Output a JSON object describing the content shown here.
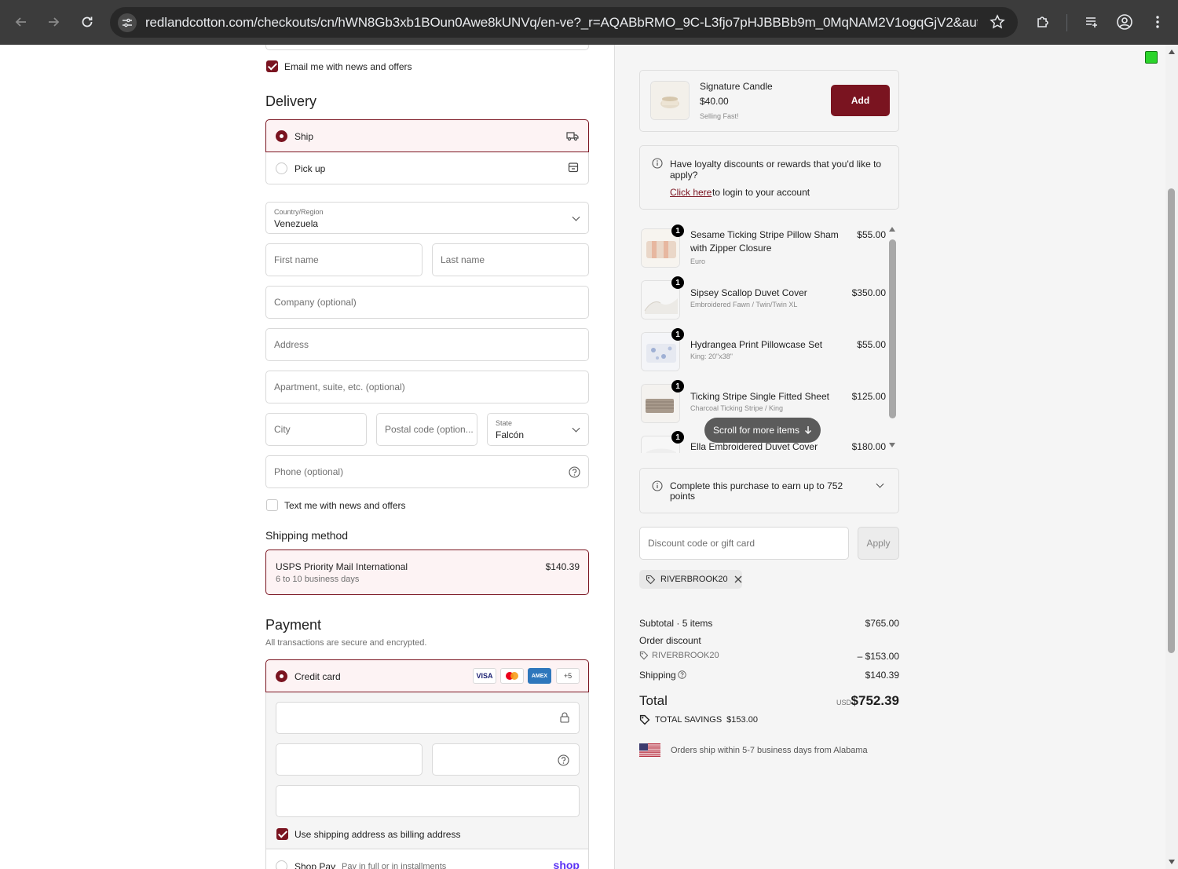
{
  "browser": {
    "url": "redlandcotton.com/checkouts/cn/hWN8Gb3xb1BOun0Awe8kUNVq/en-ve?_r=AQABbRMO_9C-L3fjo7pHJBBBb9m_0MqNAM2V1ogqGjV2&auto_r..."
  },
  "contact": {
    "email_news_label": "Email me with news and offers",
    "email_news_checked": true
  },
  "delivery": {
    "heading": "Delivery",
    "options": [
      {
        "label": "Ship",
        "selected": true,
        "icon": "truck-icon"
      },
      {
        "label": "Pick up",
        "selected": false,
        "icon": "store-icon"
      }
    ],
    "country": {
      "label": "Country/Region",
      "value": "Venezuela"
    },
    "first_name_placeholder": "First name",
    "last_name_placeholder": "Last name",
    "company_placeholder": "Company (optional)",
    "address_placeholder": "Address",
    "apartment_placeholder": "Apartment, suite, etc. (optional)",
    "city_placeholder": "City",
    "postal_placeholder": "Postal code (option...",
    "state": {
      "label": "State",
      "value": "Falcón"
    },
    "phone_placeholder": "Phone (optional)",
    "text_news_label": "Text me with news and offers"
  },
  "shipping_method": {
    "heading": "Shipping method",
    "name": "USPS Priority Mail International",
    "eta": "6 to 10 business days",
    "price": "$140.39"
  },
  "payment": {
    "heading": "Payment",
    "subheading": "All transactions are secure and encrypted.",
    "credit_card_label": "Credit card",
    "card_brands": [
      "VISA",
      "",
      "AMEX",
      "+5"
    ],
    "billing_label": "Use shipping address as billing address",
    "shop_pay_label": "Shop Pay",
    "shop_pay_sub": "Pay in full or in installments",
    "shop_logo": "shop"
  },
  "upsell": {
    "name": "Signature Candle",
    "price": "$40.00",
    "note": "Selling Fast!",
    "button": "Add"
  },
  "loyalty": {
    "question": "Have loyalty discounts or rewards that you'd like to apply?",
    "link": "Click here",
    "rest": "to login to your account"
  },
  "cart": {
    "items": [
      {
        "qty": "1",
        "title": "Sesame Ticking Stripe Pillow Sham with Zipper Closure",
        "variant": "Euro",
        "price": "$55.00"
      },
      {
        "qty": "1",
        "title": "Sipsey Scallop Duvet Cover",
        "variant": "Embroidered Fawn / Twin/Twin XL",
        "price": "$350.00"
      },
      {
        "qty": "1",
        "title": "Hydrangea Print Pillowcase Set",
        "variant": "King: 20\"x38\"",
        "price": "$55.00"
      },
      {
        "qty": "1",
        "title": "Ticking Stripe Single Fitted Sheet",
        "variant": "Charcoal Ticking Stripe / King",
        "price": "$125.00"
      },
      {
        "qty": "1",
        "title": "Ella Embroidered Duvet Cover",
        "variant": "",
        "price": "$180.00"
      }
    ],
    "scroll_hint": "Scroll for more items"
  },
  "points": {
    "text": "Complete this purchase to earn up to 752 points"
  },
  "discount": {
    "placeholder": "Discount code or gift card",
    "apply": "Apply",
    "code": "RIVERBROOK20"
  },
  "summary": {
    "subtotal_label": "Subtotal · 5 items",
    "subtotal": "$765.00",
    "order_discount_label": "Order discount",
    "discount_code": "RIVERBROOK20",
    "discount_amount": "– $153.00",
    "shipping_label": "Shipping",
    "shipping": "$140.39",
    "total_label": "Total",
    "currency": "USD",
    "total": "$752.39",
    "savings_label": "TOTAL SAVINGS",
    "savings": "$153.00",
    "ship_note": "Orders ship within 5-7 business days from Alabama"
  }
}
